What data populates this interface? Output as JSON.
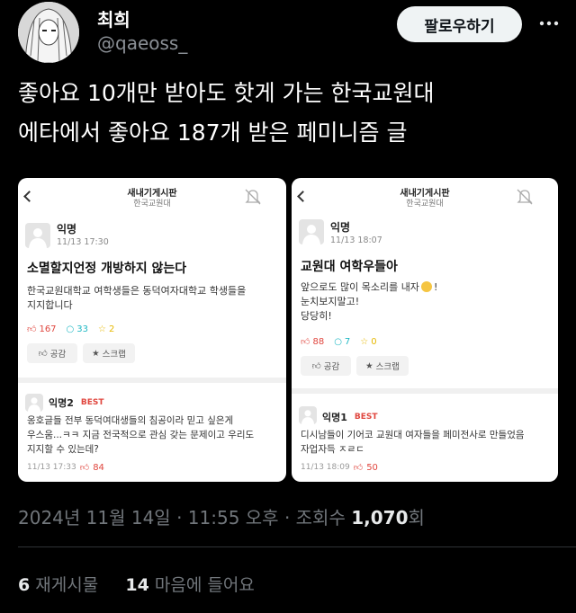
{
  "tweet": {
    "author_name": "최희",
    "author_handle": "@qaeoss_",
    "follow_label": "팔로우하기",
    "more_icon": "ellipsis-icon",
    "text_line1": "좋아요 10개만 받아도 핫게 가는 한국교원대",
    "text_line2": "에타에서 좋아요 187개 받은 페미니즘 글",
    "time": "2024년 11월 14일 · 11:55 오후",
    "views_label": "조회수",
    "views_count": "1,070",
    "views_suffix": "회",
    "retweets_count": "6",
    "retweets_label": "재게시물",
    "likes_count": "14",
    "likes_label": "마음에 들어요"
  },
  "left_post": {
    "board_title": "새내기게시판",
    "board_sub": "한국교원대",
    "author": "익명",
    "time": "11/13 17:30",
    "title": "소멸할지언정 개방하지 않는다",
    "body_line1": "한국교원대학교 여학생들은 동덕여자대학교 학생들을",
    "body_line2": "지지합니다",
    "likes": "167",
    "comments": "33",
    "scraps": "2",
    "like_btn": "공감",
    "scrap_btn": "스크랩",
    "comment": {
      "author": "익명2",
      "badge": "BEST",
      "line1": "옹호글들 전부 동덕여대생들의 침공이라 믿고 싶은게",
      "line2": "우스움...ㅋㅋ 지금 전국적으로 관심 갖는 문제이고 우리도",
      "line3": "지지할 수 있는데?",
      "time": "11/13 17:33",
      "likes": "84"
    }
  },
  "right_post": {
    "board_title": "새내기게시판",
    "board_sub": "한국교원대",
    "author": "익명",
    "time": "11/13 18:07",
    "title": "교원대 여학우들아",
    "body_line1": "앞으로도 많이 목소리를 내자",
    "body_line1_end": "!",
    "body_line2": "눈치보지말고!",
    "body_line3": "당당히!",
    "likes": "88",
    "comments": "7",
    "scraps": "0",
    "like_btn": "공감",
    "scrap_btn": "스크랩",
    "comment": {
      "author": "익명1",
      "badge": "BEST",
      "line1": "디시남들이 기어코 교원대 여자들을 페미전사로 만들었음",
      "line2": "자업자득 ㅈㄹㄷ",
      "time": "11/13 18:09",
      "likes": "50"
    }
  }
}
